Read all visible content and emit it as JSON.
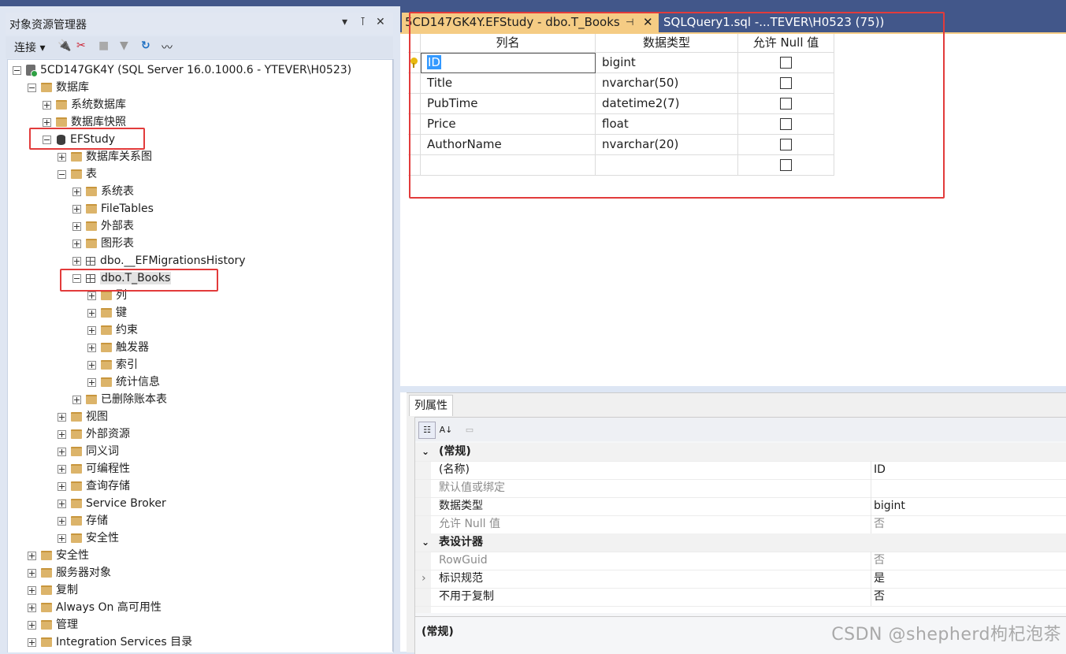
{
  "object_explorer": {
    "title": "对象资源管理器",
    "title_buttons": [
      "▾",
      "⊺",
      "✕"
    ],
    "toolbar": {
      "connect_label": "连接"
    },
    "tree": [
      {
        "label": "5CD147GK4Y (SQL Server 16.0.1000.6 - YTEVER\\H0523)",
        "level": 0,
        "expander": "minus",
        "icon": "server-icon"
      },
      {
        "label": "数据库",
        "level": 1,
        "expander": "minus",
        "icon": "folder-icon"
      },
      {
        "label": "系统数据库",
        "level": 2,
        "expander": "plus",
        "icon": "folder-icon"
      },
      {
        "label": "数据库快照",
        "level": 2,
        "expander": "plus",
        "icon": "folder-icon"
      },
      {
        "label": "EFStudy",
        "level": 2,
        "expander": "minus",
        "icon": "database-icon"
      },
      {
        "label": "数据库关系图",
        "level": 3,
        "expander": "plus",
        "icon": "folder-icon"
      },
      {
        "label": "表",
        "level": 3,
        "expander": "minus",
        "icon": "folder-icon"
      },
      {
        "label": "系统表",
        "level": 4,
        "expander": "plus",
        "icon": "folder-icon"
      },
      {
        "label": "FileTables",
        "level": 4,
        "expander": "plus",
        "icon": "folder-icon"
      },
      {
        "label": "外部表",
        "level": 4,
        "expander": "plus",
        "icon": "folder-icon"
      },
      {
        "label": "图形表",
        "level": 4,
        "expander": "plus",
        "icon": "folder-icon"
      },
      {
        "label": "dbo.__EFMigrationsHistory",
        "level": 4,
        "expander": "plus",
        "icon": "table-icon"
      },
      {
        "label": "dbo.T_Books",
        "level": 4,
        "expander": "minus",
        "icon": "table-icon",
        "selected": true
      },
      {
        "label": "列",
        "level": 5,
        "expander": "plus",
        "icon": "folder-icon"
      },
      {
        "label": "键",
        "level": 5,
        "expander": "plus",
        "icon": "folder-icon"
      },
      {
        "label": "约束",
        "level": 5,
        "expander": "plus",
        "icon": "folder-icon"
      },
      {
        "label": "触发器",
        "level": 5,
        "expander": "plus",
        "icon": "folder-icon"
      },
      {
        "label": "索引",
        "level": 5,
        "expander": "plus",
        "icon": "folder-icon"
      },
      {
        "label": "统计信息",
        "level": 5,
        "expander": "plus",
        "icon": "folder-icon"
      },
      {
        "label": "已删除账本表",
        "level": 4,
        "expander": "plus",
        "icon": "folder-icon"
      },
      {
        "label": "视图",
        "level": 3,
        "expander": "plus",
        "icon": "folder-icon"
      },
      {
        "label": "外部资源",
        "level": 3,
        "expander": "plus",
        "icon": "folder-icon"
      },
      {
        "label": "同义词",
        "level": 3,
        "expander": "plus",
        "icon": "folder-icon"
      },
      {
        "label": "可编程性",
        "level": 3,
        "expander": "plus",
        "icon": "folder-icon"
      },
      {
        "label": "查询存储",
        "level": 3,
        "expander": "plus",
        "icon": "folder-icon"
      },
      {
        "label": "Service Broker",
        "level": 3,
        "expander": "plus",
        "icon": "folder-icon"
      },
      {
        "label": "存储",
        "level": 3,
        "expander": "plus",
        "icon": "folder-icon"
      },
      {
        "label": "安全性",
        "level": 3,
        "expander": "plus",
        "icon": "folder-icon"
      },
      {
        "label": "安全性",
        "level": 1,
        "expander": "plus",
        "icon": "folder-icon"
      },
      {
        "label": "服务器对象",
        "level": 1,
        "expander": "plus",
        "icon": "folder-icon"
      },
      {
        "label": "复制",
        "level": 1,
        "expander": "plus",
        "icon": "folder-icon"
      },
      {
        "label": "Always On 高可用性",
        "level": 1,
        "expander": "plus",
        "icon": "folder-icon"
      },
      {
        "label": "管理",
        "level": 1,
        "expander": "plus",
        "icon": "folder-icon"
      },
      {
        "label": "Integration Services 目录",
        "level": 1,
        "expander": "plus",
        "icon": "folder-icon"
      }
    ]
  },
  "document_tabs": {
    "active": "5CD147GK4Y.EFStudy - dbo.T_Books",
    "other": "SQLQuery1.sql -...TEVER\\H0523 (75))",
    "pin_glyph": "⊣",
    "close_glyph": "✕"
  },
  "designer_grid": {
    "headers": [
      "列名",
      "数据类型",
      "允许 Null 值"
    ],
    "rows": [
      {
        "name": "ID",
        "type": "bigint",
        "allow_null": false,
        "current": true
      },
      {
        "name": "Title",
        "type": "nvarchar(50)",
        "allow_null": false
      },
      {
        "name": "PubTime",
        "type": "datetime2(7)",
        "allow_null": false
      },
      {
        "name": "Price",
        "type": "float",
        "allow_null": false
      },
      {
        "name": "AuthorName",
        "type": "nvarchar(20)",
        "allow_null": false
      },
      {
        "name": "",
        "type": "",
        "allow_null": false
      }
    ]
  },
  "column_properties": {
    "tab_label": "列属性",
    "rows": [
      {
        "kind": "category",
        "name": "(常规)",
        "chevron": "⌄"
      },
      {
        "kind": "prop",
        "name": "(名称)",
        "value": "ID",
        "dim": false
      },
      {
        "kind": "prop",
        "name": "默认值或绑定",
        "value": "",
        "dim": true
      },
      {
        "kind": "prop",
        "name": "数据类型",
        "value": "bigint",
        "dim": false
      },
      {
        "kind": "prop",
        "name": "允许 Null 值",
        "value": "否",
        "dim": true
      },
      {
        "kind": "category",
        "name": "表设计器",
        "chevron": "⌄"
      },
      {
        "kind": "prop",
        "name": "RowGuid",
        "value": "否",
        "dim": true
      },
      {
        "kind": "prop",
        "name": "标识规范",
        "value": "是",
        "dim": false,
        "expandable": true
      },
      {
        "kind": "prop",
        "name": "不用于复制",
        "value": "否",
        "dim": false
      }
    ],
    "description_title": "(常规)"
  },
  "watermark": "CSDN @shepherd枸杞泡茶",
  "colors": {
    "tab_active": "#f5cc84",
    "tab_bar": "#42578a",
    "highlight_box": "#e23b3b",
    "selection": "#3399ff"
  }
}
